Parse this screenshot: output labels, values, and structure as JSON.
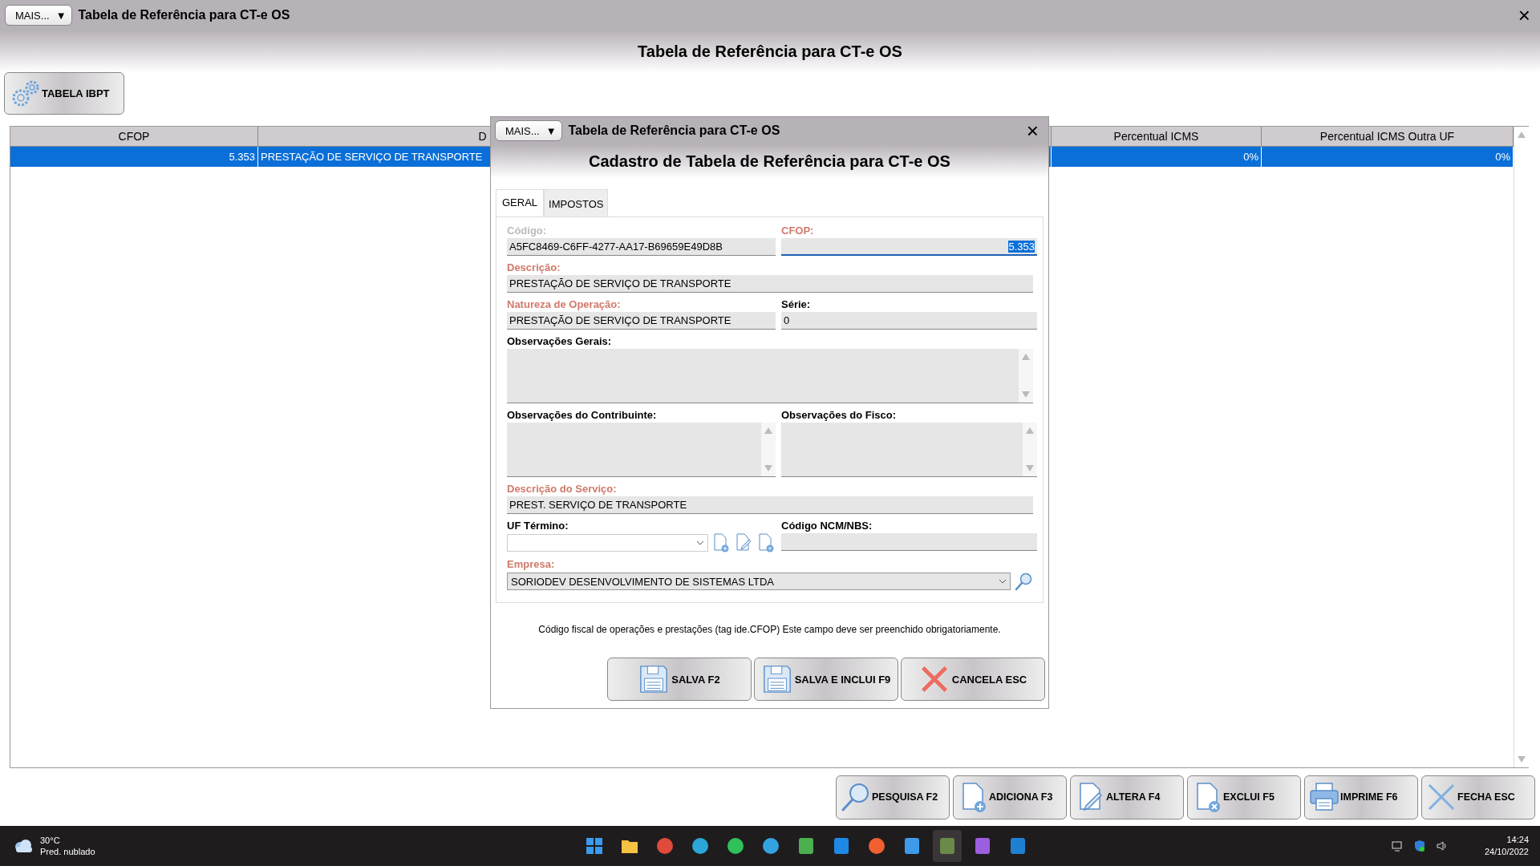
{
  "window": {
    "menu_button": "MAIS...",
    "menu_caret": "▼",
    "title": "Tabela de Referência para CT-e OS",
    "close": "×",
    "heading": "Tabela de Referência para CT-e OS"
  },
  "toolbar": {
    "button": "TABELA IBPT"
  },
  "table": {
    "columns": [
      "CFOP",
      "D",
      "Percentual ICMS",
      "Percentual ICMS Outra UF"
    ],
    "rows": [
      {
        "selected": true,
        "cells": [
          "5.353",
          "PRESTAÇÃO DE SERVIÇO DE TRANSPORTE",
          "0%",
          "0%"
        ]
      }
    ]
  },
  "dialog": {
    "menu_button": "MAIS...",
    "menu_caret": "▼",
    "title": "Tabela de Referência para CT-e OS",
    "close": "×",
    "heading": "Cadastro de Tabela de Referência para CT-e OS",
    "tabs": [
      {
        "label": "GERAL",
        "selected": true
      },
      {
        "label": "IMPOSTOS",
        "selected": false
      }
    ],
    "form_rows": [
      [
        {
          "kind": "text",
          "label": "Código:",
          "value": "A5FC8469-C6FF-4277-AA17-B69659E49D8B",
          "required": false,
          "disabled": true,
          "focused": false
        },
        {
          "kind": "text",
          "label": "CFOP:",
          "value": "5.353",
          "required": true,
          "disabled": false,
          "focused": true
        }
      ],
      [
        {
          "kind": "text",
          "label": "Descrição:",
          "value": "PRESTAÇÃO DE SERVIÇO DE TRANSPORTE",
          "required": true,
          "disabled": false,
          "focused": false
        }
      ],
      [
        {
          "kind": "text",
          "label": "Natureza de Operação:",
          "value": "PRESTAÇÃO DE SERVIÇO DE TRANSPORTE",
          "required": true,
          "disabled": false,
          "focused": false
        },
        {
          "kind": "text",
          "label": "Série:",
          "value": "0",
          "required": false,
          "disabled": false,
          "focused": false
        }
      ],
      [
        {
          "kind": "memo",
          "label": "Observações Gerais:",
          "required": false,
          "disabled": false
        }
      ],
      [
        {
          "kind": "memo",
          "label": "Observações do Contribuinte:",
          "required": false,
          "disabled": false
        },
        {
          "kind": "memo",
          "label": "Observações do Fisco:",
          "required": false,
          "disabled": false
        }
      ],
      [
        {
          "kind": "text",
          "label": "Descrição do Serviço:",
          "value": "PREST. SERVIÇO DE TRANSPORTE",
          "required": true,
          "disabled": false,
          "focused": false
        }
      ],
      [
        {
          "kind": "select_tools",
          "label": "UF Término:",
          "required": false,
          "disabled": false
        },
        {
          "kind": "text",
          "label": "Código NCM/NBS:",
          "required": false,
          "disabled": false,
          "focused": false
        }
      ],
      [
        {
          "kind": "select_lookup",
          "label": "Empresa:",
          "value": "SORIODEV DESENVOLVIMENTO DE SISTEMAS LTDA",
          "required": true,
          "disabled": false
        }
      ]
    ],
    "hint": "Código fiscal de operações e prestações (tag ide.CFOP) Este campo deve ser preenchido obrigatoriamente.",
    "buttons": [
      {
        "kind": "save",
        "label": "SALVA F2"
      },
      {
        "kind": "save",
        "label": "SALVA E INCLUI F9"
      },
      {
        "kind": "cancel",
        "label": "CANCELA ESC"
      }
    ]
  },
  "actions": [
    {
      "kind": "search",
      "label": "PESQUISA F2"
    },
    {
      "kind": "add",
      "label": "ADICIONA F3"
    },
    {
      "kind": "edit",
      "label": "ALTERA F4"
    },
    {
      "kind": "delete",
      "label": "EXCLUI F5"
    },
    {
      "kind": "print",
      "label": "IMPRIME F6"
    },
    {
      "kind": "close",
      "label": "FECHA ESC"
    }
  ],
  "taskbar": {
    "weather": {
      "temperature": "30°C",
      "condition": "Pred. nublado"
    },
    "apps": [
      {
        "kind": "start",
        "color": "#3a9bf0",
        "selected": false
      },
      {
        "kind": "folder",
        "color": "#f5c242",
        "selected": false
      },
      {
        "kind": "round",
        "color": "#e04a3a",
        "selected": false
      },
      {
        "kind": "round",
        "color": "#2aa7d8",
        "selected": false
      },
      {
        "kind": "round",
        "color": "#2fc25a",
        "selected": false
      },
      {
        "kind": "round",
        "color": "#33a3e0",
        "selected": false
      },
      {
        "kind": "tile",
        "color": "#4caf50",
        "selected": false
      },
      {
        "kind": "tile",
        "color": "#1e88e5",
        "selected": false
      },
      {
        "kind": "round",
        "color": "#f06030",
        "selected": false
      },
      {
        "kind": "tile",
        "color": "#3d9be9",
        "selected": false
      },
      {
        "kind": "tile",
        "color": "#6a8a4a",
        "selected": true
      },
      {
        "kind": "tile",
        "color": "#9c5fe0",
        "selected": false
      },
      {
        "kind": "tile",
        "color": "#1f7fd0",
        "selected": false
      }
    ],
    "time": "14:24",
    "date": "24/10/2022"
  }
}
